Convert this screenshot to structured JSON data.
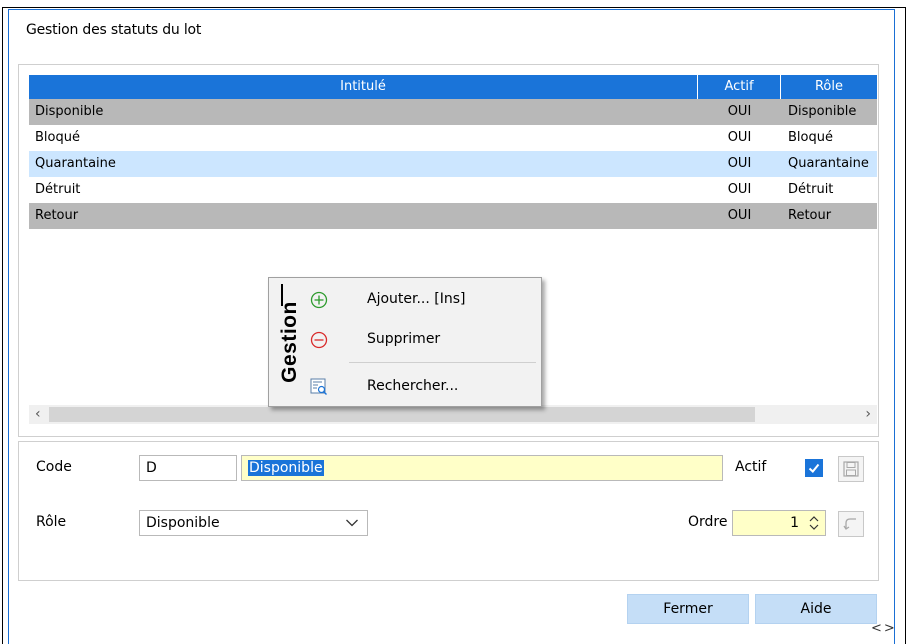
{
  "window": {
    "title": "Gestion des statuts du lot"
  },
  "grid": {
    "columns": [
      "Intitulé",
      "Actif",
      "Rôle"
    ],
    "rows": [
      {
        "intitule": "Disponible",
        "actif": "OUI",
        "role": "Disponible"
      },
      {
        "intitule": "Bloqué",
        "actif": "OUI",
        "role": "Bloqué"
      },
      {
        "intitule": "Quarantaine",
        "actif": "OUI",
        "role": "Quarantaine"
      },
      {
        "intitule": "Détruit",
        "actif": "OUI",
        "role": "Détruit"
      },
      {
        "intitule": "Retour",
        "actif": "OUI",
        "role": "Retour"
      }
    ]
  },
  "context_menu": {
    "side_label": "Gestion",
    "items": [
      {
        "label": "Ajouter... [Ins]",
        "icon": "add-circle-icon"
      },
      {
        "label": "Supprimer",
        "icon": "remove-circle-icon"
      },
      {
        "label": "Rechercher...",
        "icon": "search-list-icon"
      }
    ]
  },
  "form": {
    "code_label": "Code",
    "code_value": "D",
    "intitule_value": "Disponible",
    "actif_label": "Actif",
    "actif_checked": true,
    "role_label": "Rôle",
    "role_value": "Disponible",
    "ordre_label": "Ordre",
    "ordre_value": "1"
  },
  "buttons": {
    "close": "Fermer",
    "help": "Aide"
  },
  "colors": {
    "header_blue": "#1a74d9",
    "selected_gray": "#b8b8b8",
    "highlight_blue": "#cce6ff",
    "field_yellow": "#ffffc8",
    "button_blue": "#c5def7"
  }
}
